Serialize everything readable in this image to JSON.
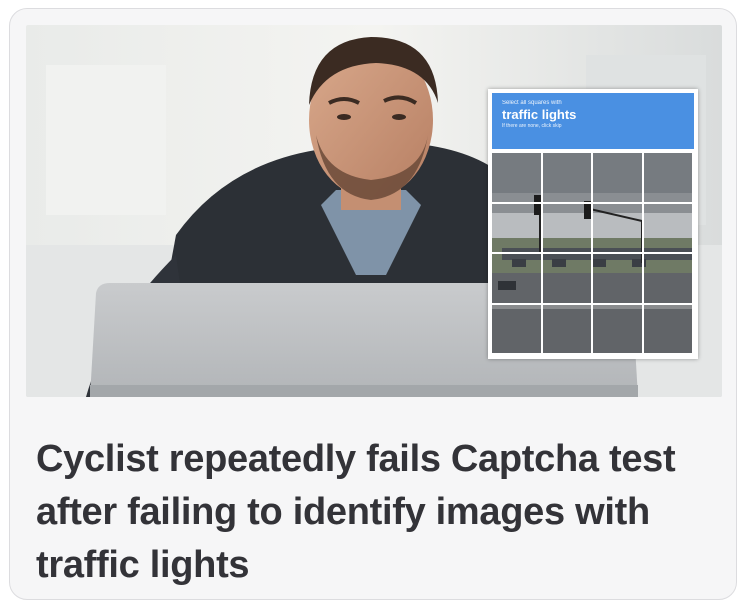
{
  "headline": "Cyclist repeatedly fails Captcha test after failing to identify images with traffic lights",
  "captcha": {
    "instruction": "Select all squares with",
    "target": "traffic lights",
    "hint": "If there are none, click skip",
    "grid": "4x4"
  },
  "colors": {
    "captcha_accent": "#4a90e2",
    "headline_text": "#333338",
    "card_background": "#f6f6f7"
  }
}
